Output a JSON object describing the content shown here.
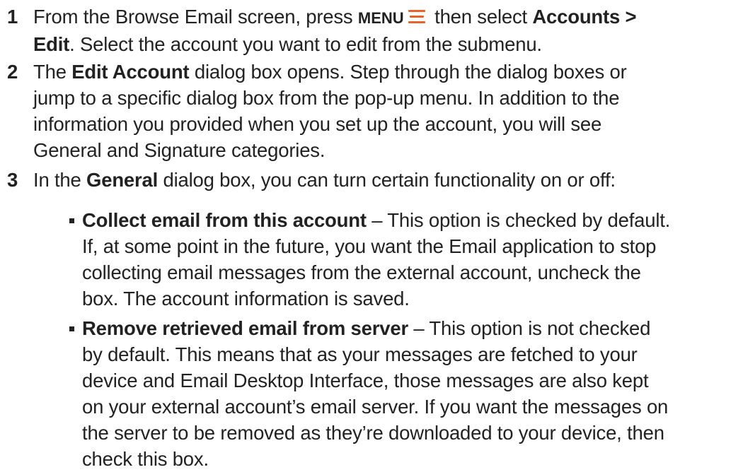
{
  "steps": [
    {
      "number": "1",
      "text_a": "From the Browse Email screen, press ",
      "key": "MENU",
      "text_b": " then select ",
      "bold_b": "Accounts >",
      "line2_bold": "Edit",
      "text_c": ". Select the account you want to edit from the submenu."
    },
    {
      "number": "2",
      "text_a": "The ",
      "bold_a": "Edit Account",
      "text_b": " dialog box opens. Step through the dialog boxes or",
      "line2": "jump to a specific dialog box from the pop-up menu. In addition to the",
      "line3": "information you provided when you set up the account, you will see",
      "line4": "General and Signature categories."
    },
    {
      "number": "3",
      "text_a": "In the ",
      "bold_a": "General",
      "text_b": " dialog box, you can turn certain functionality on or off:"
    }
  ],
  "bullets": [
    {
      "title": "Collect email from this account",
      "line1_rest": " – This option is checked by default.",
      "lines": [
        "If, at some point in the future, you want the Email application to stop",
        "collecting email messages from the external account, uncheck the",
        "box. The account information is saved."
      ]
    },
    {
      "title": "Remove retrieved email from server",
      "line1_rest": " – This option is not checked",
      "lines": [
        "by default. This means that as your messages are fetched to your",
        "device and Email Desktop Interface, those messages are also kept",
        "on your external account’s email server. If you want the messages on",
        "the server to be removed as they’re downloaded to your device, then",
        "check this box."
      ]
    }
  ],
  "colors": {
    "text": "#222222",
    "menu_icon": "#e8622c"
  },
  "icons": {
    "menu": "menu-icon"
  }
}
